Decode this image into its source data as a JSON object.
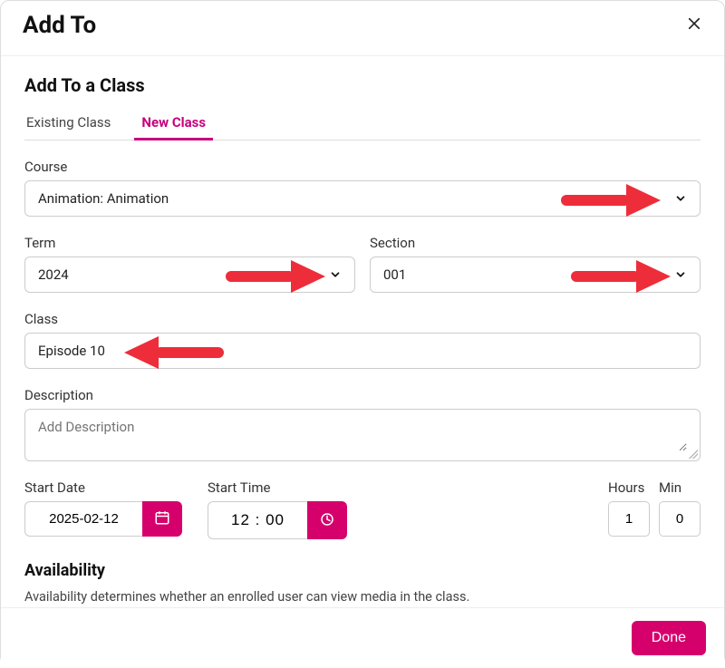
{
  "header": {
    "title": "Add To"
  },
  "form": {
    "heading": "Add To a Class",
    "tabs": {
      "existing": "Existing Class",
      "new": "New Class"
    },
    "course": {
      "label": "Course",
      "value": "Animation: Animation"
    },
    "term": {
      "label": "Term",
      "value": "2024"
    },
    "section": {
      "label": "Section",
      "value": "001"
    },
    "class": {
      "label": "Class",
      "value": "Episode 10"
    },
    "description": {
      "label": "Description",
      "placeholder": "Add Description",
      "value": ""
    },
    "start_date": {
      "label": "Start Date",
      "value": "2025-02-12"
    },
    "start_time": {
      "label": "Start Time",
      "value": "12 : 00"
    },
    "hours": {
      "label": "Hours",
      "value": "1"
    },
    "min": {
      "label": "Min",
      "value": "0"
    },
    "availability": {
      "heading": "Availability",
      "text": "Availability determines whether an enrolled user can view media in the class."
    }
  },
  "footer": {
    "done": "Done"
  }
}
